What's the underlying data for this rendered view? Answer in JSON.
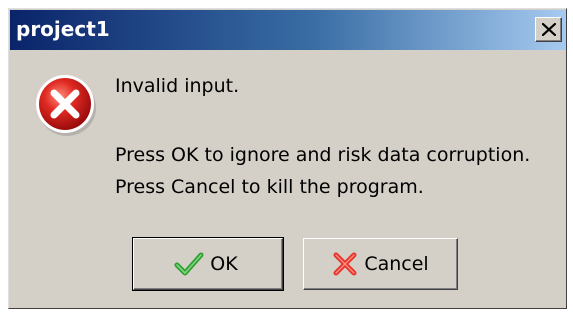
{
  "window": {
    "title": "project1"
  },
  "message": {
    "line1": "Invalid input.",
    "line2": "Press OK to ignore and risk data corruption.",
    "line3": "Press Cancel to kill the program."
  },
  "buttons": {
    "ok_label": "OK",
    "cancel_label": "Cancel"
  },
  "icons": {
    "title_close": "close-icon",
    "message": "error-icon",
    "ok": "checkmark-icon",
    "cancel": "cross-icon"
  },
  "colors": {
    "titlebar_start": "#0a246a",
    "titlebar_end": "#a6caf0",
    "dialog_bg": "#d4d0c8",
    "error_red": "#d81e1e",
    "ok_green": "#3bb33b"
  }
}
